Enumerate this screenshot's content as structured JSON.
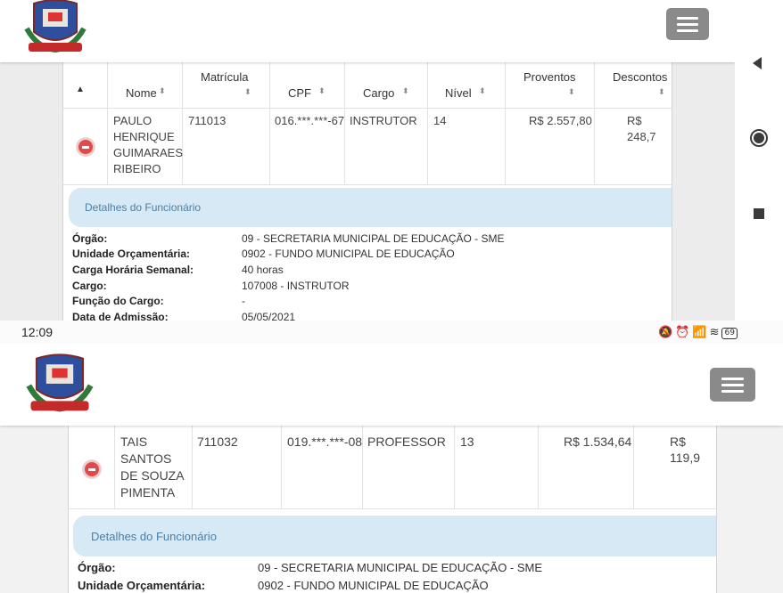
{
  "status_bar": {
    "time": "12:09",
    "battery": "69",
    "icons": [
      "silent-icon",
      "alarm-icon",
      "signal-icon",
      "wifi-icon"
    ]
  },
  "android_nav": {
    "back": "back-icon",
    "home": "home-icon",
    "recents": "recents-icon"
  },
  "table": {
    "columns": [
      {
        "label": "▲"
      },
      {
        "label": "Nome"
      },
      {
        "label": "Matrícula"
      },
      {
        "label": "CPF"
      },
      {
        "label": "Cargo"
      },
      {
        "label": "Nível"
      },
      {
        "label": "Proventos"
      },
      {
        "label": "Descontos"
      }
    ]
  },
  "top": {
    "row": {
      "nome": [
        "PAULO",
        "HENRIQUE",
        "GUIMARAES",
        "RIBEIRO"
      ],
      "matricula": "711013",
      "cpf": "016.***.***-67",
      "cargo": "INSTRUTOR",
      "nivel": "14",
      "proventos": "R$ 2.557,80",
      "descontos": "R$ 248,7"
    },
    "details_title": "Detalhes do Funcionário",
    "details": [
      {
        "label": "Órgão:",
        "value": "09 - SECRETARIA MUNICIPAL DE EDUCAÇÃO - SME"
      },
      {
        "label": "Unidade Orçamentária:",
        "value": "0902 - FUNDO MUNICIPAL DE EDUCAÇÃO"
      },
      {
        "label": "Carga Horária Semanal:",
        "value": "40 horas"
      },
      {
        "label": "Cargo:",
        "value": "107008 - INSTRUTOR"
      },
      {
        "label": "Função do Cargo:",
        "value": "-"
      },
      {
        "label": "Data de Admissão:",
        "value": "05/05/2021"
      }
    ]
  },
  "bottom": {
    "row": {
      "nome": [
        "TAIS",
        "SANTOS",
        "DE SOUZA",
        "PIMENTA"
      ],
      "matricula": "711032",
      "cpf": "019.***.***-08",
      "cargo": "PROFESSOR",
      "nivel": "13",
      "proventos": "R$ 1.534,64",
      "descontos": "R$ 119,9"
    },
    "details_title": "Detalhes do Funcionário",
    "details": [
      {
        "label": "Órgão:",
        "value": "09 - SECRETARIA MUNICIPAL DE EDUCAÇÃO - SME"
      },
      {
        "label": "Unidade Orçamentária:",
        "value": "0902 - FUNDO MUNICIPAL DE EDUCAÇÃO"
      }
    ]
  }
}
